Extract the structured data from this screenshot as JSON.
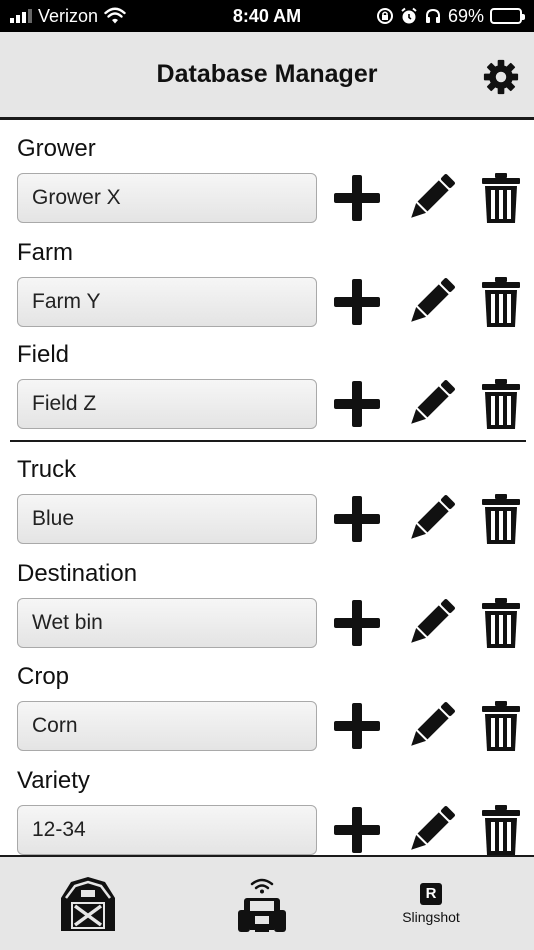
{
  "status_bar": {
    "carrier": "Verizon",
    "time": "8:40 AM",
    "battery": "69%",
    "battery_level": 0.69
  },
  "header": {
    "title": "Database Manager",
    "settings_icon": "gear-icon"
  },
  "rows": [
    {
      "label": "Grower",
      "value": "Grower X"
    },
    {
      "label": "Farm",
      "value": "Farm Y"
    },
    {
      "label": "Field",
      "value": "Field Z"
    },
    {
      "label": "Truck",
      "value": "Blue"
    },
    {
      "label": "Destination",
      "value": "Wet bin"
    },
    {
      "label": "Crop",
      "value": "Corn"
    },
    {
      "label": "Variety",
      "value": "12-34"
    }
  ],
  "row_actions": [
    "plus-icon",
    "pencil-icon",
    "trash-icon"
  ],
  "tab_bar": {
    "tabs": [
      {
        "icon": "barn-icon"
      },
      {
        "icon": "tractor-icon"
      },
      {
        "icon": "slingshot-logo-icon",
        "label": "Slingshot",
        "logo_letter": "R"
      }
    ]
  }
}
